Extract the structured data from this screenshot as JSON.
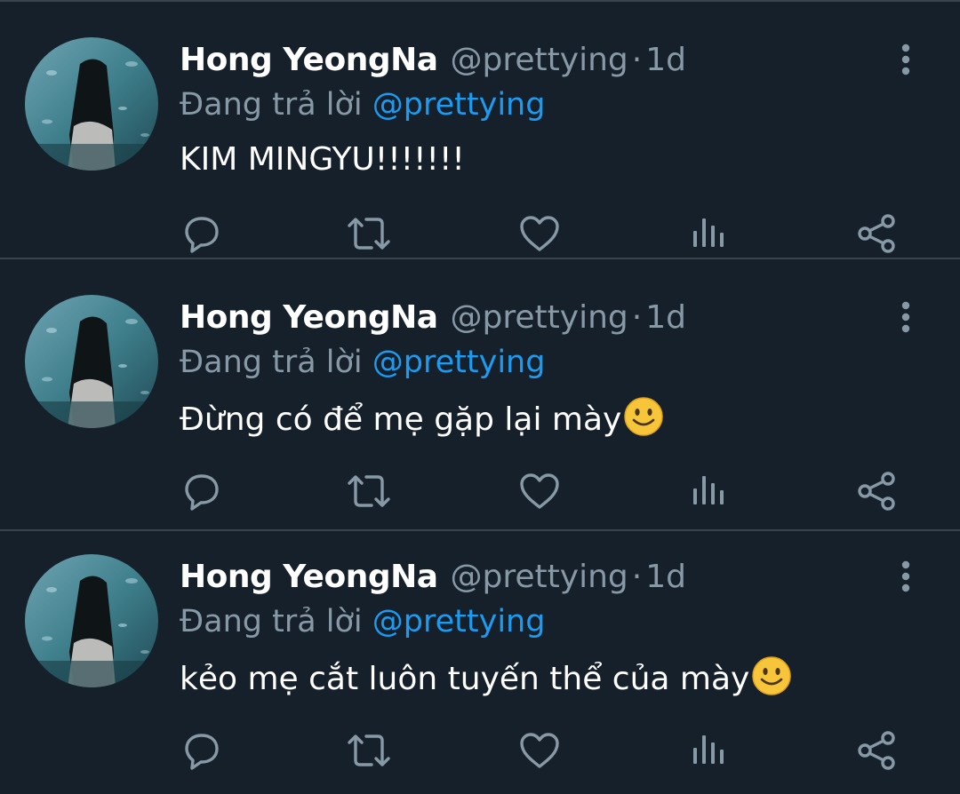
{
  "tweets": [
    {
      "author_name": "Hong YeongNa",
      "handle": "@prettying",
      "separator": "·",
      "time": "1d",
      "reply_prefix": "Đang trả lời",
      "reply_to": "@prettying",
      "text": "KIM MINGYU!!!!!!!",
      "emoji": ""
    },
    {
      "author_name": "Hong YeongNa",
      "handle": "@prettying",
      "separator": "·",
      "time": "1d",
      "reply_prefix": "Đang trả lời",
      "reply_to": "@prettying",
      "text": "Đừng có để mẹ gặp lại mày",
      "emoji": "slightly-smiling-face"
    },
    {
      "author_name": "Hong YeongNa",
      "handle": "@prettying",
      "separator": "·",
      "time": "1d",
      "reply_prefix": "Đang trả lời",
      "reply_to": "@prettying",
      "text": "kẻo mẹ cắt luôn tuyến thể của mày",
      "emoji": "slightly-smiling-face"
    }
  ],
  "action_icons": [
    "reply-icon",
    "retweet-icon",
    "like-icon",
    "analytics-icon",
    "share-icon"
  ],
  "colors": {
    "background": "#15202b",
    "divider": "#38444d",
    "secondary_text": "#8899a6",
    "mention": "#1d9bf0",
    "primary_text": "#ffffff"
  }
}
